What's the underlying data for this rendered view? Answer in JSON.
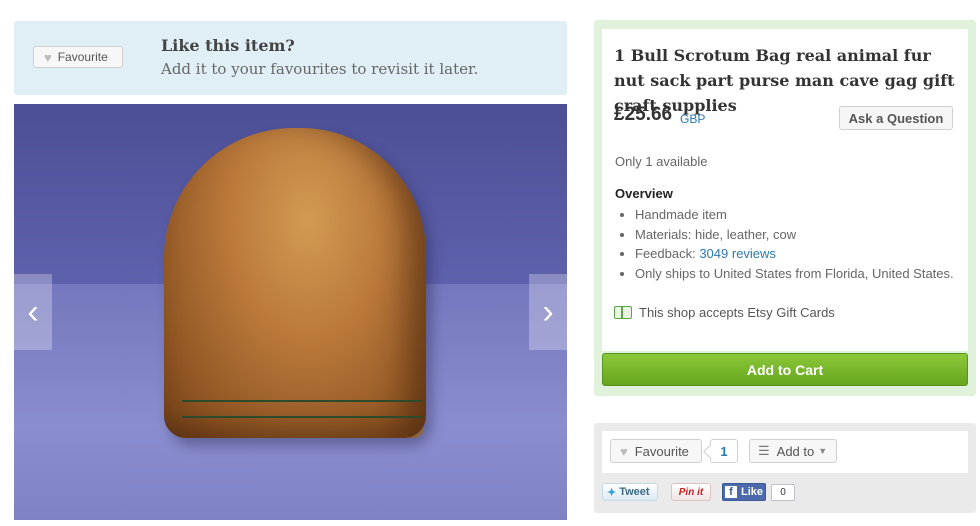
{
  "favourite_banner": {
    "button_label": "Favourite",
    "title": "Like this item?",
    "subtitle": "Add it to your favourites to revisit it later."
  },
  "listing": {
    "title": "1 Bull Scrotum Bag real animal fur nut sack part purse man cave gag gift craft supplies",
    "price": "£25.66",
    "currency": "GBP",
    "ask_button": "Ask a Question",
    "availability": "Only 1 available",
    "overview_title": "Overview",
    "overview": {
      "handmade": "Handmade item",
      "materials": "Materials: hide, leather, cow",
      "feedback_label": "Feedback: ",
      "feedback_link": "3049 reviews",
      "shipping": "Only ships to United States from Florida, United States."
    },
    "gift_card": "This shop accepts Etsy Gift Cards",
    "add_to_cart": "Add to Cart"
  },
  "image_nav": {
    "prev": "‹",
    "next": "›"
  },
  "social": {
    "favourite_label": "Favourite",
    "favourite_count": "1",
    "add_to_label": "Add to",
    "tweet": "Tweet",
    "pin": "Pin it",
    "fb_like": "Like",
    "fb_count": "0"
  },
  "colors": {
    "accent_green": "#7ab82c",
    "link_blue": "#2a7ab0",
    "banner_bg": "#e0eff5",
    "buy_box_bg": "#e0f1dc"
  },
  "icons": {
    "heart": "heart-icon",
    "list": "list-icon",
    "gift_card": "gift-card-icon",
    "twitter": "twitter-bird-icon",
    "facebook": "facebook-icon",
    "arrow_left": "chevron-left-icon",
    "arrow_right": "chevron-right-icon"
  }
}
